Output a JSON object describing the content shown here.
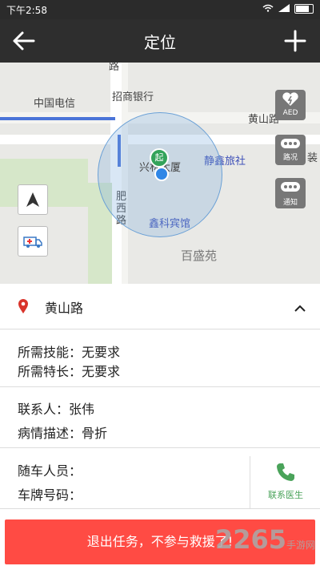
{
  "status": {
    "time": "下午2:58"
  },
  "nav": {
    "title": "定位"
  },
  "map": {
    "labels": {
      "china_telecom": "中国电信",
      "cmb_bank": "招商银行",
      "huangshan_road_map": "黄山路",
      "xinglin_tower": "兴林大厦",
      "jingxin_hotel": "静鑫旅社",
      "feixi_road": "肥西路",
      "xinke_hotel": "鑫科宾馆",
      "baisheng_yuan": "百盛苑",
      "road_fragment": "路",
      "zhuang": "装"
    },
    "side_buttons": {
      "aed": "AED",
      "road": "路况",
      "notify": "通知"
    }
  },
  "address": {
    "label": "黄山路"
  },
  "requirements": {
    "skill_label": "所需技能：",
    "skill_value": "无要求",
    "specialty_label": "所需特长：",
    "specialty_value": "无要求"
  },
  "patient": {
    "contact_label": "联系人：",
    "contact_value": "张伟",
    "condition_label": "病情描述：",
    "condition_value": "骨折"
  },
  "vehicle": {
    "staff_label": "随车人员：",
    "plate_label": "车牌号码：",
    "contact_doctor": "联系医生"
  },
  "actions": {
    "exit_label": "退出任务，不参与救援了!"
  },
  "watermark": {
    "text": "2265",
    "sub": "手游网",
    "domain": ".com"
  }
}
